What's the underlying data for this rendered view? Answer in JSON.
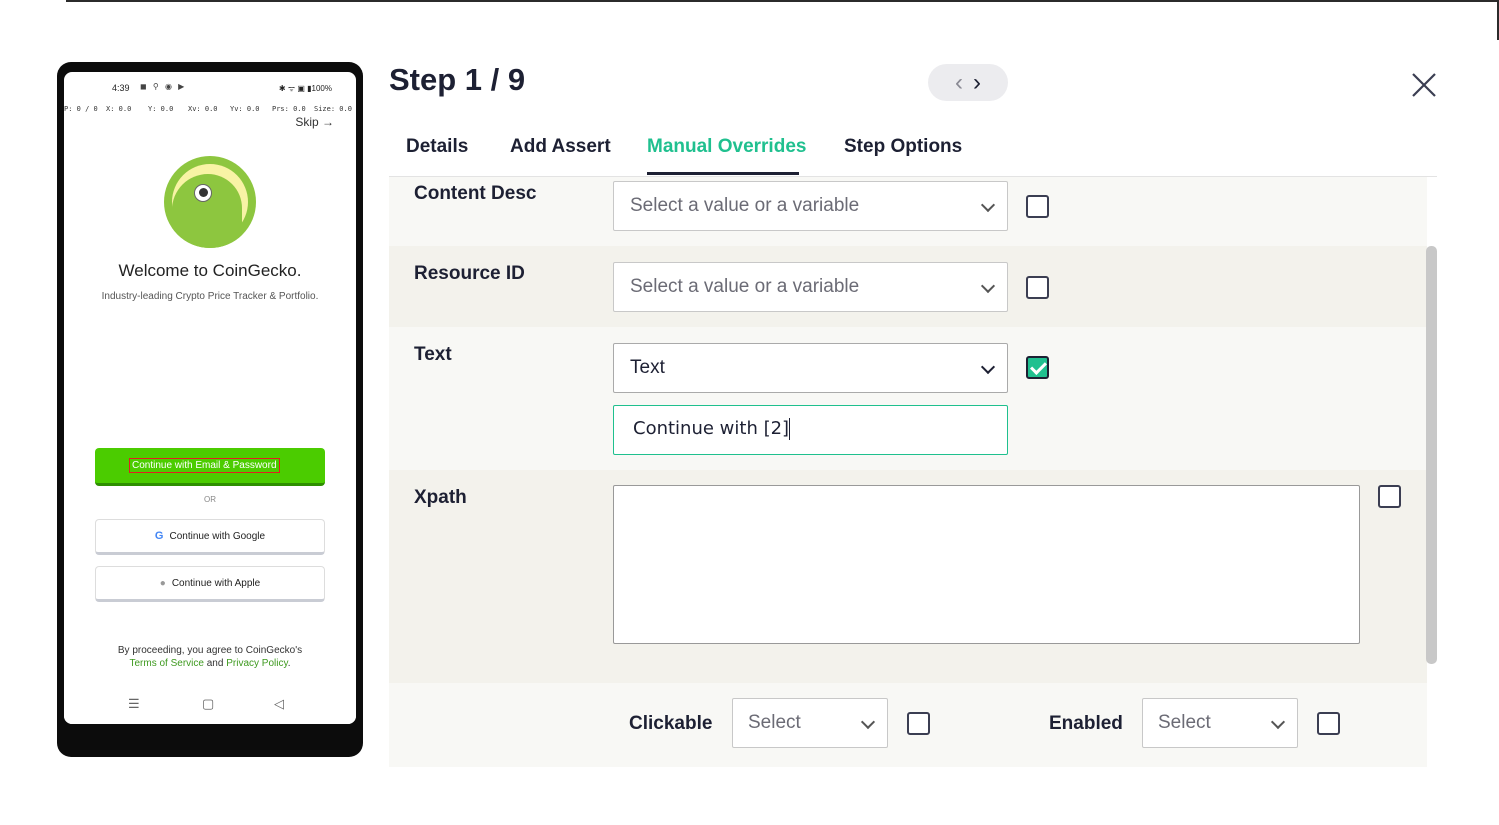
{
  "phone": {
    "status_time": "4:39",
    "status_icons": "◼ ⚲ ◉ ▶",
    "status_right": "✱ ᯤ ▣ ▮100%",
    "pointer": {
      "p": "P: 0 / 0",
      "x": "X: 0.0",
      "y": "Y: 0.0",
      "xv": "Xv: 0.0",
      "yv": "Yv: 0.0",
      "prs": "Prs: 0.0",
      "size": "Size: 0.0"
    },
    "skip": "Skip →",
    "welcome": "Welcome to CoinGecko.",
    "tagline": "Industry-leading Crypto Price Tracker & Portfolio.",
    "email_button": "Continue with Email & Password",
    "or": "OR",
    "google_button": "Continue with Google",
    "apple_button": "Continue with Apple",
    "legal_line1": "By proceeding, you agree to CoinGecko's",
    "terms": "Terms of Service",
    "and": " and ",
    "privacy": "Privacy Policy",
    "period": ".",
    "nav_menu": "☰",
    "nav_home": "▢",
    "nav_back": "◁",
    "google_icon_glyph": "G",
    "apple_icon_glyph": "●"
  },
  "header": {
    "step_title": "Step 1 / 9",
    "prev_glyph": "‹",
    "next_glyph": "›"
  },
  "tabs": [
    {
      "label": "Details"
    },
    {
      "label": "Add Assert"
    },
    {
      "label": "Manual Overrides"
    },
    {
      "label": "Step Options"
    }
  ],
  "fields": {
    "content_desc": {
      "label": "Content Desc",
      "placeholder": "Select a value or a variable",
      "checked": false
    },
    "resource_id": {
      "label": "Resource ID",
      "placeholder": "Select a value or a variable",
      "checked": false
    },
    "text": {
      "label": "Text",
      "selected": "Text",
      "value": "Continue with [2]",
      "checked": true
    },
    "xpath": {
      "label": "Xpath",
      "value": "",
      "checked": false
    },
    "clickable": {
      "label": "Clickable",
      "placeholder": "Select",
      "checked": false
    },
    "enabled": {
      "label": "Enabled",
      "placeholder": "Select",
      "checked": false
    }
  },
  "colors": {
    "accent": "#20c08f",
    "brand_green": "#4bcc00",
    "text_dark": "#1d2033",
    "row_alt": "#f3f2ec"
  }
}
